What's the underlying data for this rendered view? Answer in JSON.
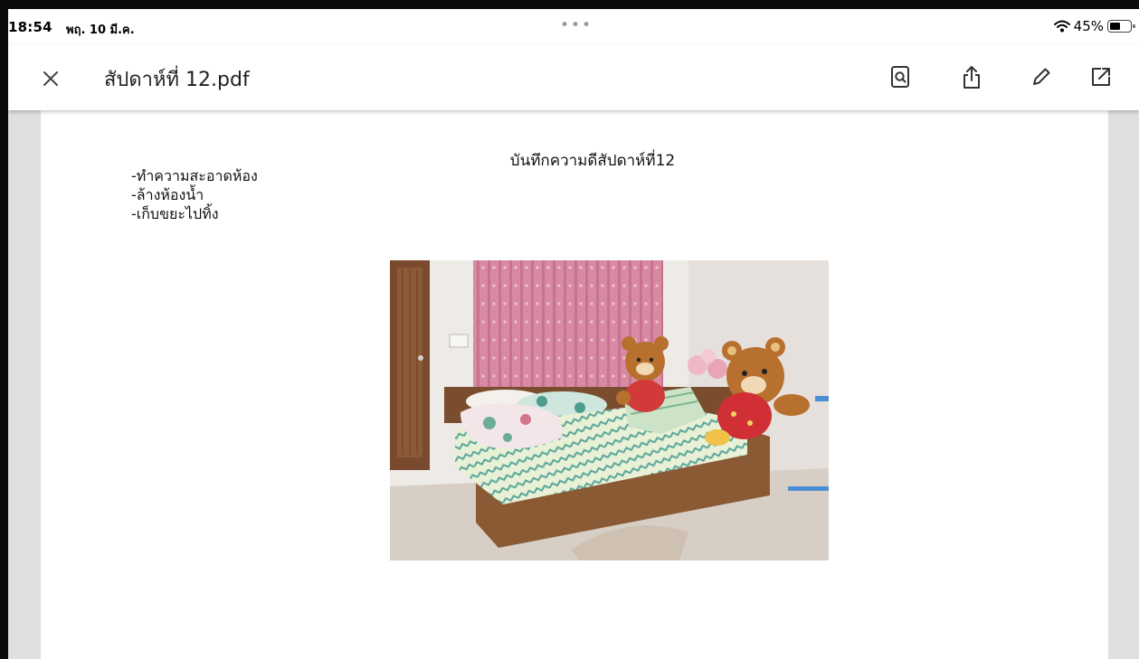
{
  "status_bar": {
    "time": "18:54",
    "date": "พฤ. 10 มี.ค.",
    "dots": "•••",
    "battery": "45%"
  },
  "toolbar": {
    "title": "สัปดาห์ที่ 12.pdf",
    "icons": [
      "close-icon",
      "search-document-icon",
      "share-icon",
      "edit-pencil-icon",
      "open-external-icon"
    ]
  },
  "document": {
    "heading": "บันทึกความดีสัปดาห์ที่12",
    "tasks": [
      "-ทำความสะอาดห้อง",
      "-ล้างห้องน้ำ",
      "-เก็บขยะไปทิ้ง"
    ],
    "photo_subject": "bedroom-photo"
  },
  "colors": {
    "viewer_background": "#dfdfdf",
    "curtain": "#d98aa3",
    "bed_frame": "#8a5a35",
    "teddy_bear": "#b8702e"
  }
}
